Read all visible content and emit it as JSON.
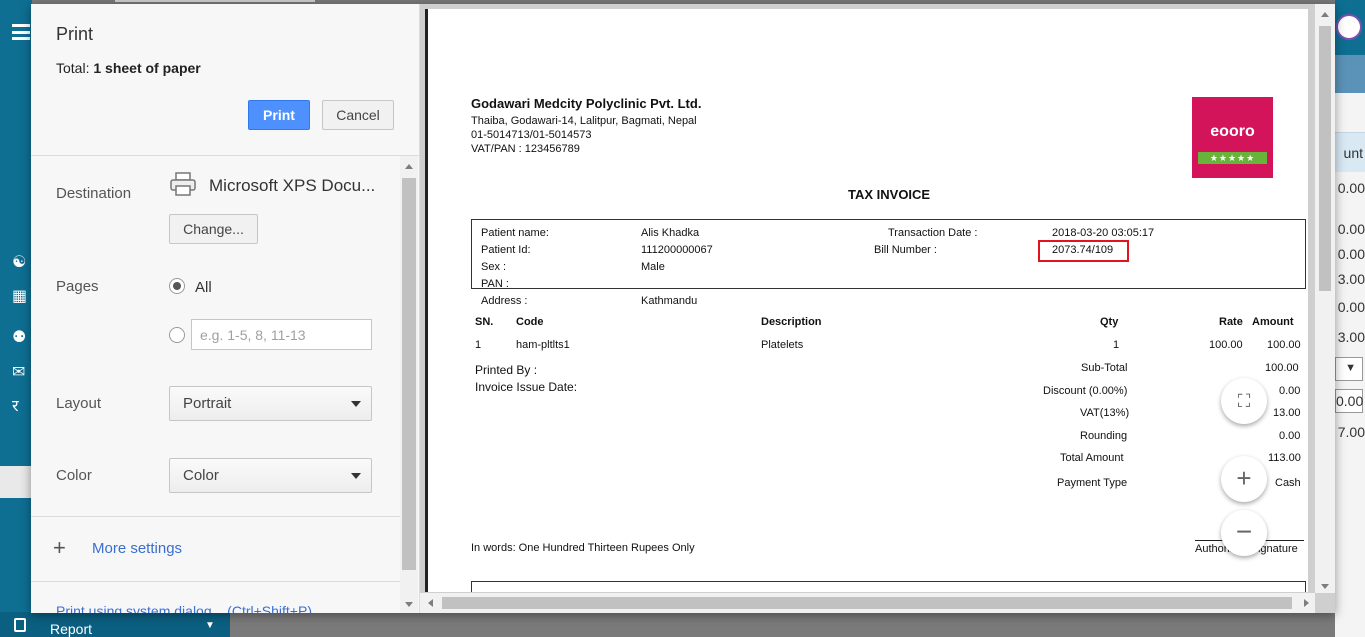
{
  "background_app": {
    "bottom_nav": {
      "report_label": "Report"
    },
    "right_column": {
      "header": "unt",
      "values": [
        "0.00",
        "0.00",
        "0.00",
        "3.00",
        "0.00",
        "3.00"
      ],
      "select_value": "▼",
      "input_value": "0.00",
      "total_value": "7.00"
    }
  },
  "print_dialog": {
    "title": "Print",
    "total_prefix": "Total:",
    "total_value": "1 sheet of paper",
    "print_button": "Print",
    "cancel_button": "Cancel",
    "destination": {
      "label": "Destination",
      "value": "Microsoft XPS Docu...",
      "change_button": "Change..."
    },
    "pages": {
      "label": "Pages",
      "all_label": "All",
      "custom_placeholder": "e.g. 1-5, 8, 11-13"
    },
    "layout": {
      "label": "Layout",
      "value": "Portrait"
    },
    "color": {
      "label": "Color",
      "value": "Color"
    },
    "more_settings": "More settings",
    "system_dialog": "Print using system dialog... (Ctrl+Shift+P)"
  },
  "invoice": {
    "company_name": "Godawari Medcity Polyclinic Pvt. Ltd.",
    "address": "Thaiba, Godawari-14, Lalitpur, Bagmati, Nepal",
    "phone": "01-5014713/01-5014573",
    "vat_pan": "VAT/PAN : 123456789",
    "logo_text": "eooro",
    "logo_stars": "★★★★★",
    "title": "TAX INVOICE",
    "patient_name_label": "Patient name:",
    "patient_name": "Alis Khadka",
    "patient_id_label": "Patient Id:",
    "patient_id": "111200000067",
    "sex_label": "Sex :",
    "sex": "Male",
    "pan_label": "PAN :",
    "address_label": "Address :",
    "address_value": "Kathmandu",
    "transaction_date_label": "Transaction Date :",
    "transaction_date": "2018-03-20 03:05:17",
    "bill_number_label": "Bill Number :",
    "bill_number": "2073.74/109",
    "columns": {
      "sn": "SN.",
      "code": "Code",
      "description": "Description",
      "qty": "Qty",
      "rate": "Rate",
      "amount": "Amount"
    },
    "items": [
      {
        "sn": "1",
        "code": "ham-pltlts1",
        "description": "Platelets",
        "qty": "1",
        "rate": "100.00",
        "amount": "100.00"
      }
    ],
    "printed_by": "Printed By :",
    "invoice_issue_date": "Invoice Issue Date:",
    "subtotal_label": "Sub-Total",
    "subtotal": "100.00",
    "discount_label": "Discount (0.00%)",
    "discount": "0.00",
    "vat_label": "VAT(13%)",
    "vat": "13.00",
    "rounding_label": "Rounding",
    "rounding": "0.00",
    "total_label": "Total Amount",
    "total": "113.00",
    "payment_type_label": "Payment Type",
    "payment_type": "Cash",
    "in_words": "In words: One Hundred Thirteen Rupees Only",
    "signature": "Authorized Signature"
  },
  "colors": {
    "app_blue": "#0e6f93",
    "print_button": "#4d90fe",
    "highlight_red": "#e0141d",
    "logo_pink": "#d4145a"
  }
}
